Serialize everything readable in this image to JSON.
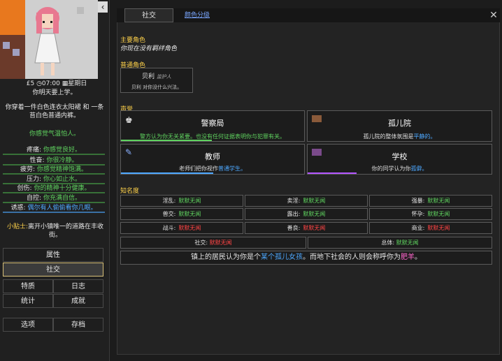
{
  "sidebar": {
    "money": "£5",
    "time": "07:00",
    "weekday": "星期日",
    "line_school": "你明天要上学。",
    "clothes": "你穿着一件白色连衣太阳裙 和 一条苔白色普通内裤。",
    "mood": "你感觉气温怕人。",
    "stats": [
      {
        "label": "疼痛:",
        "value": "你感觉良好。",
        "color": "#5fd35f"
      },
      {
        "label": "性奋:",
        "value": "你很冷静。",
        "color": "#5fd35f"
      },
      {
        "label": "疲劳:",
        "value": "你感觉精神饱满。",
        "color": "#5fd35f"
      },
      {
        "label": "压力:",
        "value": "你心如止水。",
        "color": "#5fd35f"
      },
      {
        "label": "创伤:",
        "value": "你的精神十分健康。",
        "color": "#5fd35f"
      },
      {
        "label": "自控:",
        "value": "你充满自信。",
        "color": "#5fd35f"
      },
      {
        "label": "诱惑:",
        "value": "偶尔有人偷偷看你几眼。",
        "color": "#4da8ff"
      }
    ],
    "tip_label": "小贴士:",
    "tip_text": "离开小镇唯一的道路在丰收街。",
    "nav": {
      "attributes": "属性",
      "social": "社交",
      "traits": "特质",
      "journal": "日志",
      "statistics": "统计",
      "achievements": "成就",
      "options": "选项",
      "saves": "存档"
    }
  },
  "tabs": {
    "social": "社交",
    "color_grade": "颜色分级"
  },
  "main_char": {
    "title": "主要角色",
    "text": "你现在没有羁绊角色"
  },
  "normal_char": {
    "title": "普通角色",
    "name": "贝利",
    "role": "监护人",
    "desc": "贝利 对你没什么兴法。"
  },
  "reputation": {
    "title": "声誉",
    "items": [
      {
        "title": "警察局",
        "desc": "警方认为你无关紧要。也没有任何证据表明你与犯罪有关。",
        "desc_color": "#5fd35f",
        "bar_color": "#5fd35f"
      },
      {
        "title": "孤儿院",
        "desc_pre": "孤儿院的整体氛围是",
        "desc_hl": "平静的。",
        "desc_color": "#4da8ff",
        "bar_color": ""
      },
      {
        "title": "教师",
        "desc_pre": "老师们把你视作",
        "desc_hl": "普通学生。",
        "desc_color": "#4da8ff",
        "bar_color": "#4da8ff"
      },
      {
        "title": "学校",
        "desc_pre": "你的同学认为你",
        "desc_hl": "孤僻。",
        "desc_color": "#4da8ff",
        "bar_color": "#b455ff"
      }
    ]
  },
  "fame": {
    "title": "知名度",
    "rows": [
      [
        {
          "label": "淫乱:",
          "value": "默默无闻"
        },
        {
          "label": "卖淫:",
          "value": "默默无闻"
        },
        {
          "label": "强暴:",
          "value": "默默无闻"
        }
      ],
      [
        {
          "label": "兽交:",
          "value": "默默无闻"
        },
        {
          "label": "露出:",
          "value": "默默无闻"
        },
        {
          "label": "怀孕:",
          "value": "默默无闻"
        }
      ],
      [
        {
          "label": "战斗:",
          "value": "默默无闻",
          "red": true
        },
        {
          "label": "善良:",
          "value": "默默无闻",
          "red": true
        },
        {
          "label": "商业:",
          "value": "默默无闻",
          "red": true
        }
      ]
    ],
    "social": {
      "label": "社交:",
      "value": "默默无闻"
    },
    "total": {
      "label": "总体:",
      "value": "默默无闻"
    },
    "summary_pre": "镇上的居民认为你是个",
    "summary_hl1": "某个孤儿女孩",
    "summary_mid": "。而地下社会的人则会称呼你为",
    "summary_hl2": "肥羊",
    "summary_end": "。"
  },
  "colors": {
    "accent": "#ffd24a",
    "green": "#5fd35f",
    "blue": "#4da8ff",
    "pink": "#ff66cc",
    "red": "#ff4444"
  }
}
